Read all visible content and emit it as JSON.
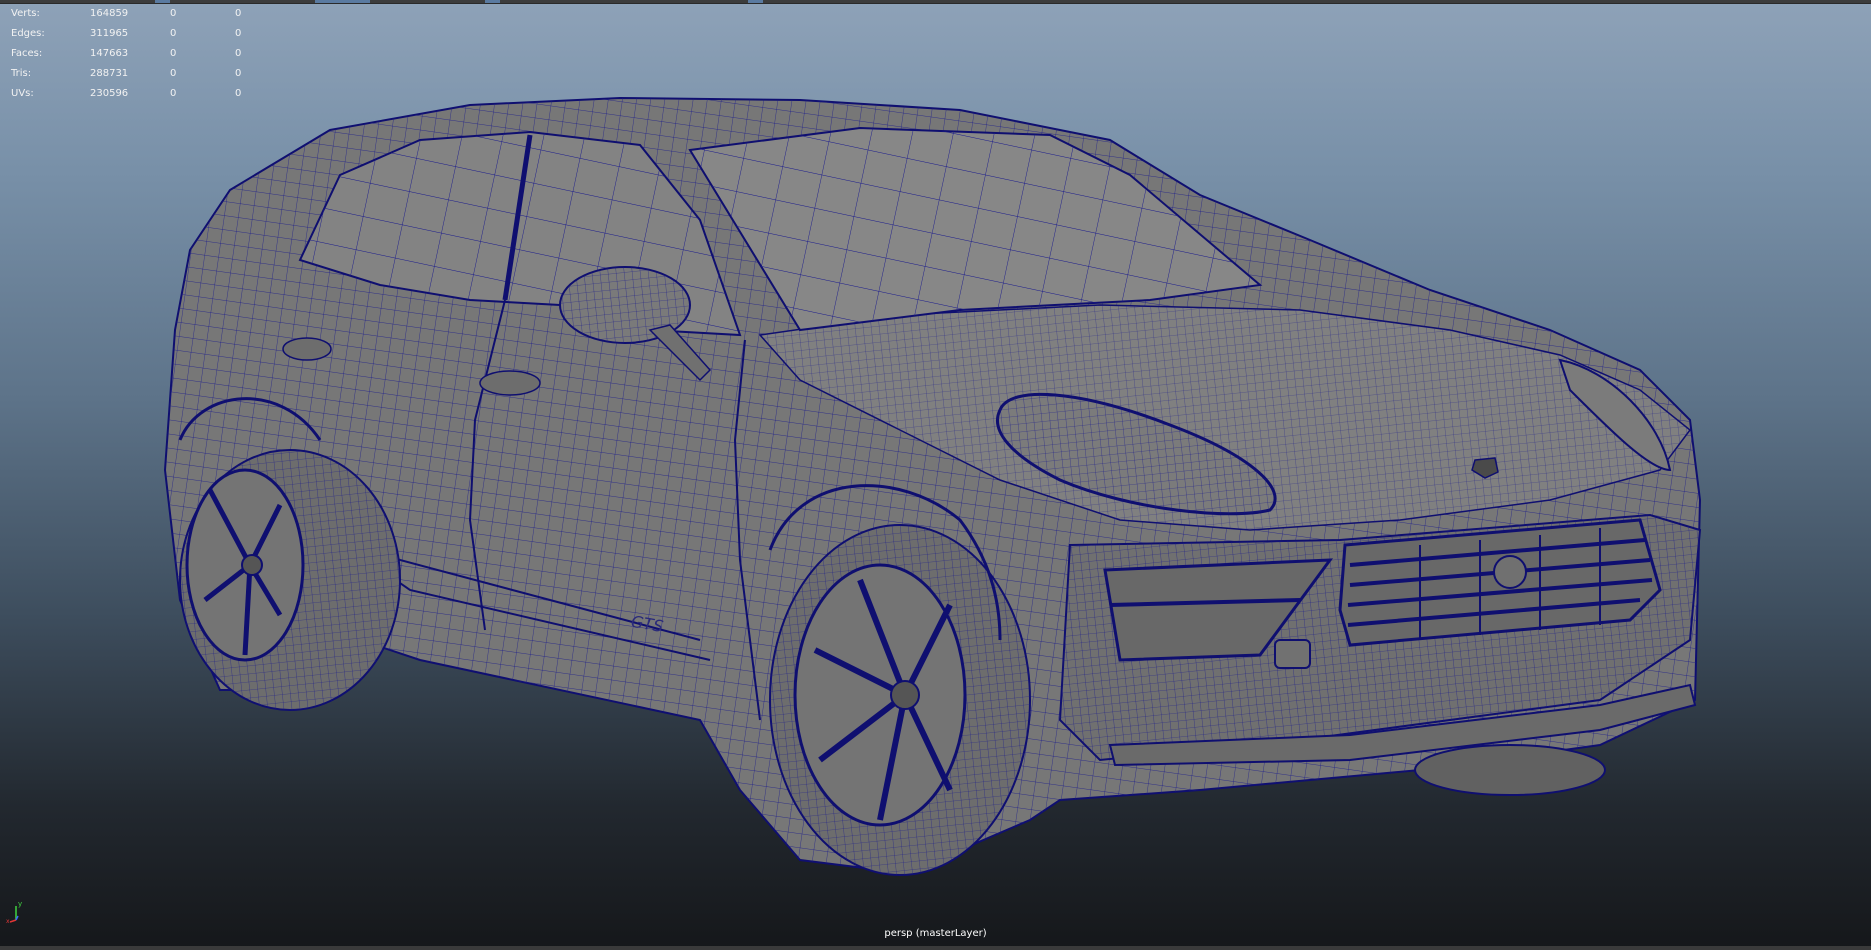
{
  "viewport": {
    "camera_label": "persp (masterLayer)"
  },
  "hud": {
    "rows": [
      {
        "label": "Verts:",
        "value": "164859",
        "c1": "0",
        "c2": "0"
      },
      {
        "label": "Edges:",
        "value": "311965",
        "c1": "0",
        "c2": "0"
      },
      {
        "label": "Faces:",
        "value": "147663",
        "c1": "0",
        "c2": "0"
      },
      {
        "label": "Tris:",
        "value": "288731",
        "c1": "0",
        "c2": "0"
      },
      {
        "label": "UVs:",
        "value": "230596",
        "c1": "0",
        "c2": "0"
      }
    ]
  },
  "axis_gizmo": {
    "y_label": "y",
    "x_label": "x"
  },
  "model": {
    "badge_text": "GTS"
  },
  "colors": {
    "wire": "#1a1a8c",
    "body": "#7d7d7d",
    "body_dark": "#5e5e5e",
    "glass": "#8a8a8a"
  }
}
